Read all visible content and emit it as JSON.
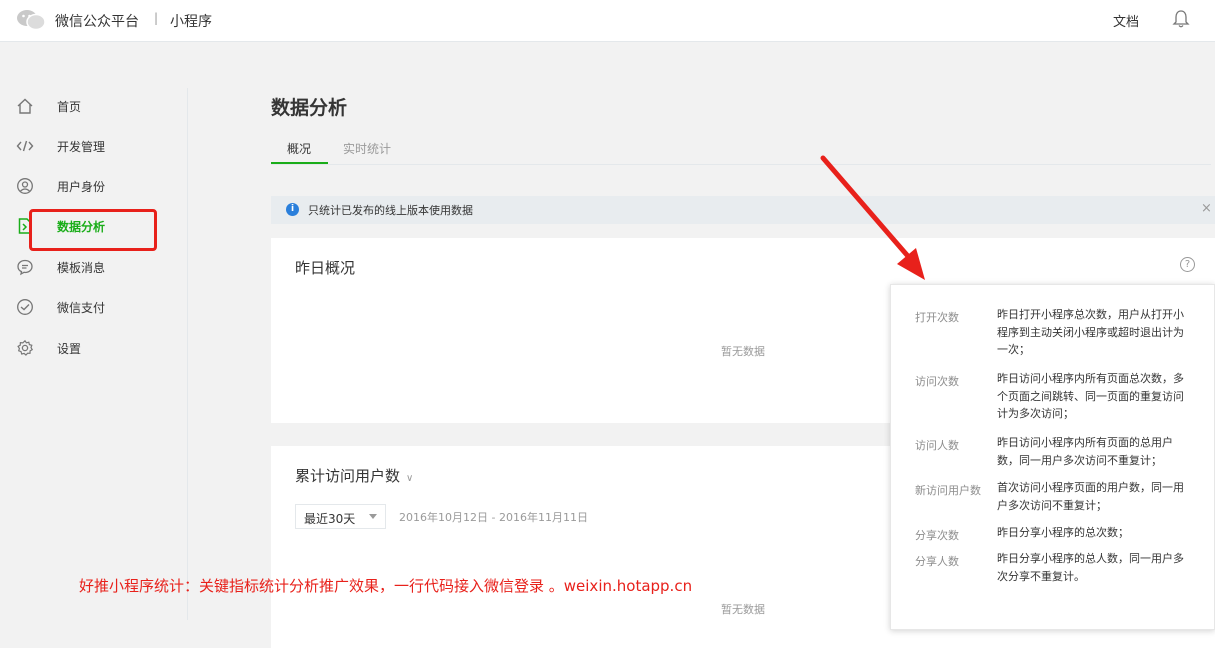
{
  "header": {
    "brand": "微信公众平台",
    "separator": "|",
    "subtitle": "小程序",
    "docs_label": "文档"
  },
  "sidebar": {
    "items": [
      {
        "label": "首页",
        "icon": "home-icon"
      },
      {
        "label": "开发管理",
        "icon": "code-icon"
      },
      {
        "label": "用户身份",
        "icon": "user-icon"
      },
      {
        "label": "数据分析",
        "icon": "data-icon",
        "active": true
      },
      {
        "label": "模板消息",
        "icon": "message-icon"
      },
      {
        "label": "微信支付",
        "icon": "payment-icon"
      },
      {
        "label": "设置",
        "icon": "gear-icon"
      }
    ]
  },
  "main": {
    "title": "数据分析",
    "tabs": [
      {
        "label": "概况",
        "active": true
      },
      {
        "label": "实时统计",
        "active": false
      }
    ],
    "notice": {
      "icon": "info-icon",
      "text": "只统计已发布的线上版本使用数据",
      "close": "×"
    },
    "yesterday_card": {
      "title": "昨日概况",
      "help": "?",
      "empty": "暂无数据"
    },
    "cumulative_card": {
      "title": "累计访问用户数",
      "range_value": "最近30天",
      "date_range": "2016年10月12日 - 2016年11月11日",
      "empty": "暂无数据"
    }
  },
  "tooltip": {
    "entries": [
      {
        "term": "打开次数",
        "definition": "昨日打开小程序总次数，用户从打开小程序到主动关闭小程序或超时退出计为一次；"
      },
      {
        "term": "访问次数",
        "definition": "昨日访问小程序内所有页面总次数，多个页面之间跳转、同一页面的重复访问计为多次访问；"
      },
      {
        "term": "访问人数",
        "definition": "昨日访问小程序内所有页面的总用户数，同一用户多次访问不重复计；"
      },
      {
        "term": "新访问用户数",
        "definition": "首次访问小程序页面的用户数，同一用户多次访问不重复计；"
      },
      {
        "term": "分享次数",
        "definition": "昨日分享小程序的总次数；"
      },
      {
        "term": "分享人数",
        "definition": "昨日分享小程序的总人数，同一用户多次分享不重复计。"
      }
    ]
  },
  "overlay": {
    "promo_text": "好推小程序统计：关键指标统计分析推广效果，一行代码接入微信登录 。weixin.hotapp.cn"
  },
  "colors": {
    "accent": "#1aad19",
    "annotation": "#e8211b",
    "info": "#2a7fdb"
  }
}
